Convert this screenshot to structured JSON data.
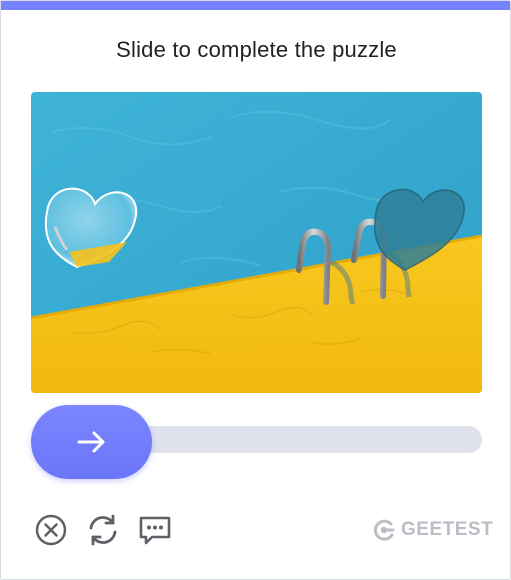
{
  "title": "Slide to complete the puzzle",
  "slider": {
    "icon": "arrow-right-icon",
    "progress": 0
  },
  "footer": {
    "close_icon": "close-circle-icon",
    "refresh_icon": "refresh-icon",
    "feedback_icon": "chat-dots-icon",
    "brand": "GEETEST",
    "brand_icon": "geetest-logo-icon"
  },
  "colors": {
    "accent": "#7681ff",
    "track": "#dfe2ec",
    "pool_water": "#3aaed3",
    "pool_deck": "#f7c21e",
    "icon_gray": "#5f5f66",
    "brand_gray": "#bcbcc4"
  }
}
